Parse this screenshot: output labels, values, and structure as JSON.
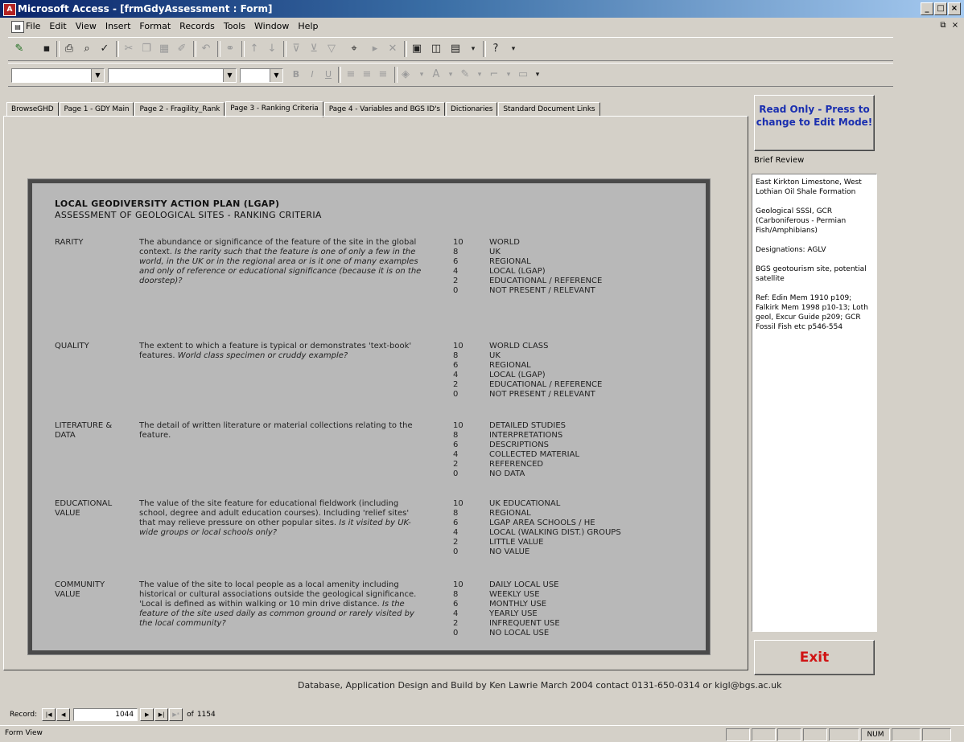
{
  "window": {
    "title": "Microsoft Access - [frmGdyAssessment : Form]",
    "controls": [
      "_",
      "□",
      "×"
    ]
  },
  "menu": {
    "items": [
      "File",
      "Edit",
      "View",
      "Insert",
      "Format",
      "Records",
      "Tools",
      "Window",
      "Help"
    ],
    "doc_controls": [
      "⧉",
      "×"
    ]
  },
  "tabs": [
    "BrowseGHD",
    "Page 1 - GDY Main",
    "Page 2 - Fragility_Rank",
    "Page 3 - Ranking Criteria",
    "Page 4 - Variables and BGS ID's",
    "Dictionaries",
    "Standard Document Links"
  ],
  "active_tab_index": 3,
  "criteria": {
    "heading": "LOCAL GEODIVERSITY ACTION PLAN (LGAP)",
    "subheading": "ASSESSMENT OF GEOLOGICAL SITES - RANKING CRITERIA",
    "items": [
      {
        "name": "RARITY",
        "desc": "The abundance or significance of the feature of the site in the global context.",
        "desc_italic": "Is the rarity such that the feature is one of only a few in the world, in the UK or in the regional area or is it one of many examples and only of reference or educational significance (because it is on the doorstep)?",
        "scores": [
          "10",
          "8",
          "6",
          "4",
          "2",
          "0"
        ],
        "labels": [
          "WORLD",
          "UK",
          "REGIONAL",
          "LOCAL (LGAP)",
          "EDUCATIONAL / REFERENCE",
          "NOT PRESENT / RELEVANT"
        ]
      },
      {
        "name": "QUALITY",
        "desc": "The extent to which a feature is typical or demonstrates 'text-book' features.",
        "desc_italic": "World class specimen or cruddy example?",
        "scores": [
          "10",
          "8",
          "6",
          "4",
          "2",
          "0"
        ],
        "labels": [
          "WORLD CLASS",
          "UK",
          "REGIONAL",
          "LOCAL (LGAP)",
          "EDUCATIONAL / REFERENCE",
          "NOT PRESENT / RELEVANT"
        ]
      },
      {
        "name": "LITERATURE & DATA",
        "desc": "The detail of written literature or material collections relating to the feature.",
        "desc_italic": "",
        "scores": [
          "10",
          "8",
          "6",
          "4",
          "2",
          "0"
        ],
        "labels": [
          "DETAILED STUDIES",
          "INTERPRETATIONS",
          "DESCRIPTIONS",
          "COLLECTED MATERIAL",
          "REFERENCED",
          "NO DATA"
        ]
      },
      {
        "name": "EDUCATIONAL VALUE",
        "desc": "The value of the site feature for educational fieldwork (including school, degree and adult education courses). Including 'relief sites' that may relieve pressure on other popular sites.",
        "desc_italic": "Is it visited by UK-wide groups or local schools only?",
        "scores": [
          "10",
          "8",
          "6",
          "4",
          "2",
          "0"
        ],
        "labels": [
          "UK EDUCATIONAL",
          "REGIONAL",
          "LGAP AREA  SCHOOLS / HE",
          "LOCAL (WALKING DIST.) GROUPS",
          "LITTLE VALUE",
          "NO VALUE"
        ]
      },
      {
        "name": "COMMUNITY VALUE",
        "desc": "The value of the site to local people as a local amenity including historical or cultural associations outside the geological significance. 'Local is defined as within walking or 10 min drive distance.",
        "desc_italic": "Is the feature of the site used daily as common ground or rarely visited by the local community?",
        "scores": [
          "10",
          "8",
          "6",
          "4",
          "2",
          "0"
        ],
        "labels": [
          "DAILY LOCAL USE",
          "WEEKLY USE",
          "MONTHLY USE",
          "YEARLY USE",
          "INFREQUENT USE",
          "NO LOCAL USE"
        ]
      }
    ]
  },
  "sidebar": {
    "readonly_button": "Read Only - Press to change to Edit Mode!",
    "brief_label": "Brief Review",
    "brief_paragraphs": [
      "East Kirkton Limestone, West Lothian Oil Shale Formation",
      "Geological SSSI, GCR (Carboniferous - Permian Fish/Amphibians)",
      "Designations: AGLV",
      "BGS geotourism site, potential satellite",
      "Ref: Edin Mem 1910 p109; Falkirk Mem 1998 p10-13; Loth geol, Excur Guide p209; GCR Fossil Fish etc p546-554"
    ],
    "exit_label": "Exit"
  },
  "footer": {
    "credit": "Database, Application Design and Build by Ken Lawrie March 2004 contact 0131-650-0314 or kigl@bgs.ac.uk"
  },
  "record_nav": {
    "label": "Record:",
    "current": "1044",
    "of_label": "of",
    "total": "1154"
  },
  "status": {
    "text": "Form View",
    "num": "NUM"
  }
}
